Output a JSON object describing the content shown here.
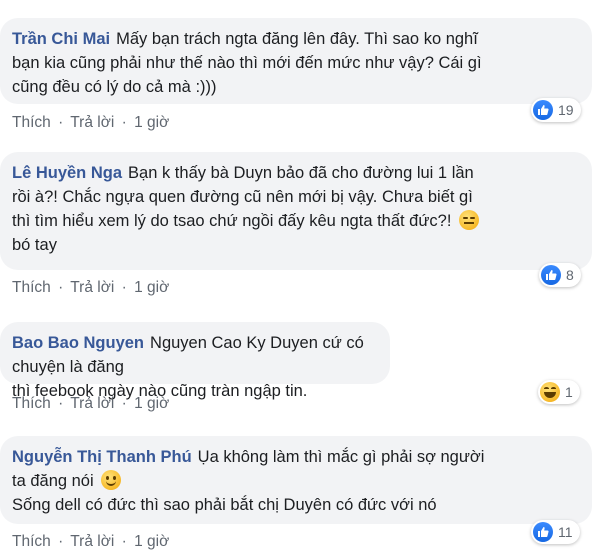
{
  "actions": {
    "like": "Thích",
    "reply": "Trả lời",
    "separator": "·"
  },
  "comments": [
    {
      "author": "Trần Chi Mai",
      "text": "Mấy bạn trách ngta đăng lên đây. Thì sao ko nghĩ\nbạn kia cũng phải như thế nào thì mới đến mức như vậy? Cái gì\ncũng đều có lý do cả mà :)))",
      "time": "1 giờ",
      "reaction_icon": "like-icon",
      "reaction_count": "19"
    },
    {
      "author": "Lê Huyền Nga",
      "text": "Bạn k thấy bà Duyn bảo đã cho đường lui 1 lần\nrồi à?! Chắc ngựa quen đường cũ nên mới bị vậy. Chưa biết gì\nthì tìm hiểu xem lý do tsao chứ ngồi đấy kêu ngta thất đức?!",
      "text_tail": "bó tay",
      "time": "1 giờ",
      "reaction_icon": "like-icon",
      "reaction_count": "8"
    },
    {
      "author": "Bao Bao Nguyen",
      "text": "Nguyen Cao Ky Duyen cứ có chuyện là đăng\nthì feebook ngày nào cũng tràn ngập tin.",
      "time": "1 giờ",
      "reaction_icon": "haha-icon",
      "reaction_count": "1"
    },
    {
      "author": "Nguyễn Thị Thanh Phú",
      "text": "Ụa không làm thì mắc gì phải sợ người\nta đăng nói",
      "text_tail": "Sống dell có đức thì sao phải bắt chị Duyên có đức với nó",
      "time": "1 giờ",
      "reaction_icon": "like-icon",
      "reaction_count": "11"
    }
  ]
}
